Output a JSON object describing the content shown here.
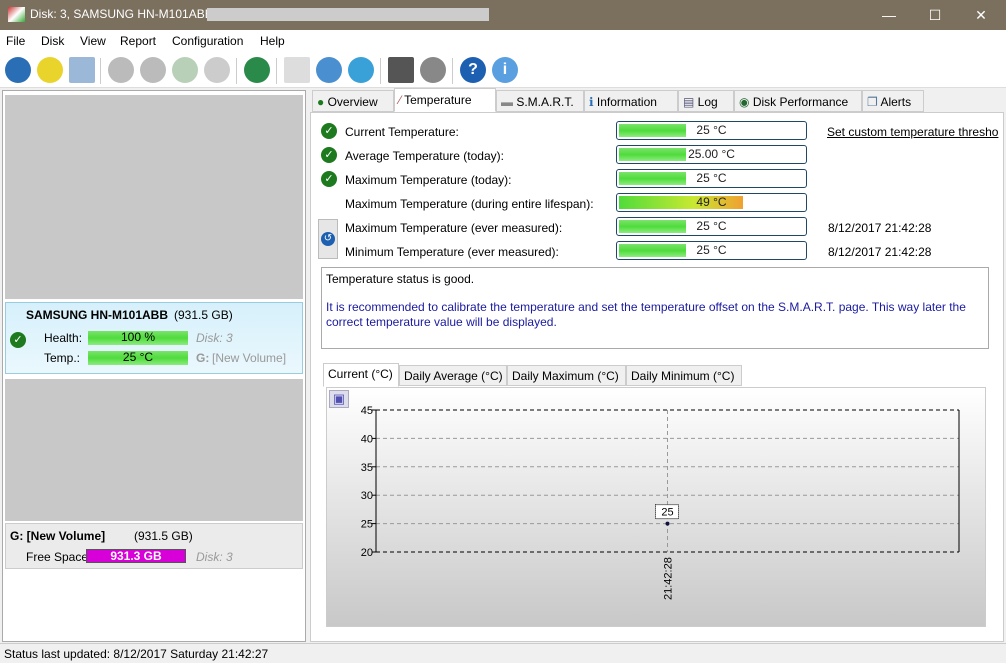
{
  "window": {
    "title": "Disk: 3, SAMSUNG HN-M101ABB [",
    "minimize": "—",
    "maximize": "☐",
    "close": "✕"
  },
  "menu": [
    "File",
    "Disk",
    "View",
    "Report",
    "Configuration",
    "Help"
  ],
  "toolbar": {
    "icons": [
      "refresh-icon",
      "alert-refresh-icon",
      "disk-icon",
      "disk-check-icon",
      "disk-clock-icon",
      "disk-ok-icon",
      "disk-search-icon",
      "globe-disk-icon",
      "report-icon",
      "send-icon",
      "network-icon",
      "laptop-settings-icon",
      "speaker-icon",
      "help-icon",
      "info-icon"
    ]
  },
  "left": {
    "disk": {
      "name": "SAMSUNG HN-M101ABB",
      "size": "(931.5 GB)",
      "health_label": "Health:",
      "health": "100 %",
      "health_pct": 100,
      "temp_label": "Temp.:",
      "temp": "25 °C",
      "disk_no": "Disk: 3",
      "volume_letter": "G:",
      "volume_name": "[New Volume]"
    },
    "volume": {
      "name": "G: [New Volume]",
      "size": "(931.5 GB)",
      "free_label": "Free Space",
      "free": "931.3 GB",
      "disk_no": "Disk: 3",
      "free_color": "#d800d8"
    }
  },
  "tabs": [
    "Overview",
    "Temperature",
    "S.M.A.R.T.",
    "Information",
    "Log",
    "Disk Performance",
    "Alerts"
  ],
  "active_tab": "Temperature",
  "temperature": {
    "rows": [
      {
        "label": "Current Temperature:",
        "value": "25 °C",
        "pct": 37,
        "ok": true,
        "extra": ""
      },
      {
        "label": "Average Temperature (today):",
        "value": "25.00 °C",
        "pct": 37,
        "ok": true,
        "extra": ""
      },
      {
        "label": "Maximum Temperature (today):",
        "value": "25 °C",
        "pct": 37,
        "ok": true,
        "extra": ""
      },
      {
        "label": "Maximum Temperature (during entire lifespan):",
        "value": "49 °C",
        "pct": 67,
        "ok": false,
        "extra": ""
      },
      {
        "label": "Maximum Temperature (ever measured):",
        "value": "25 °C",
        "pct": 37,
        "ok": false,
        "extra": "8/12/2017 21:42:28"
      },
      {
        "label": "Minimum Temperature (ever measured):",
        "value": "25 °C",
        "pct": 37,
        "ok": false,
        "extra": "8/12/2017 21:42:28"
      }
    ],
    "threshold_link": "Set custom temperature thresho",
    "status_msg": "Temperature status is good.",
    "recommendation": "It is recommended to calibrate the temperature and set the temperature offset on the S.M.A.R.T. page. This way later the correct temperature value will be displayed."
  },
  "chart_tabs": [
    "Current (°C)",
    "Daily Average (°C)",
    "Daily Maximum (°C)",
    "Daily Minimum (°C)"
  ],
  "chart_data": {
    "type": "line",
    "x": [
      "21:42:28"
    ],
    "series": [
      {
        "values": [
          25
        ]
      }
    ],
    "ylim": [
      20,
      45
    ],
    "yticks": [
      "45",
      "40",
      "35",
      "30",
      "25",
      "20"
    ],
    "data_labels": [
      "25"
    ],
    "grid": true
  },
  "status": "Status last updated: 8/12/2017 Saturday 21:42:27"
}
